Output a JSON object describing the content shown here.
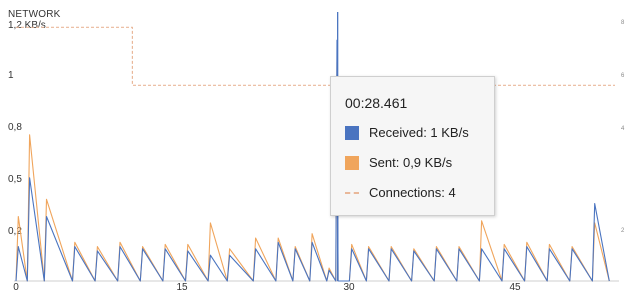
{
  "panel": {
    "title": "NETWORK",
    "right_scale_ticks": [
      "8",
      "6",
      "4",
      "2"
    ]
  },
  "tooltip": {
    "time": "00:28.461",
    "rows": [
      {
        "label": "Received: 1 KB/s",
        "color": "#4a74c0",
        "kind": "swatch"
      },
      {
        "label": "Sent: 0,9 KB/s",
        "color": "#f0a55c",
        "kind": "swatch"
      },
      {
        "label": "Connections: 4",
        "color": "#e9b89a",
        "kind": "dash"
      }
    ]
  },
  "chart_data": {
    "type": "line",
    "title": "NETWORK",
    "y_ticks": [
      "1,2 KB/s",
      "1",
      "0,8",
      "0,5",
      "0,2"
    ],
    "x_ticks": [
      "0",
      "15",
      "30",
      "45"
    ],
    "xlim": [
      0,
      53
    ],
    "ylim": [
      0,
      1.2
    ],
    "grid": false,
    "cursor_x": 28.461,
    "colors": {
      "received": "#4a74c0",
      "sent": "#f0a55c",
      "connections": "#e9b89a"
    },
    "series": [
      {
        "name": "Received",
        "x": [
          0,
          0.2,
          1,
          1.2,
          2.5,
          2.7,
          5,
          5.2,
          7,
          7.2,
          9,
          9.2,
          11,
          11.2,
          13,
          13.2,
          15,
          15.2,
          17,
          17.2,
          18.7,
          18.9,
          21,
          21.2,
          23,
          23.2,
          24.5,
          24.7,
          26,
          26.2,
          27.5,
          27.7,
          28.3,
          28.4,
          28.5,
          29.5,
          29.7,
          31,
          31.2,
          33,
          33.2,
          35,
          35.2,
          37,
          37.2,
          39,
          39.2,
          41,
          41.2,
          43,
          43.2,
          45,
          45.2,
          47,
          47.2,
          49,
          49.2,
          51,
          51.2,
          52.5
        ],
        "y": [
          0,
          0.16,
          0,
          0.48,
          0,
          0.3,
          0,
          0.16,
          0,
          0.14,
          0,
          0.16,
          0,
          0.15,
          0,
          0.15,
          0,
          0.14,
          0,
          0.12,
          0,
          0.12,
          0,
          0.15,
          0,
          0.18,
          0,
          0.15,
          0,
          0.18,
          0,
          0.05,
          0,
          1.12,
          0,
          0,
          0.15,
          0,
          0.15,
          0,
          0.15,
          0,
          0.14,
          0,
          0.15,
          0,
          0.15,
          0,
          0.15,
          0,
          0.15,
          0,
          0.16,
          0,
          0.15,
          0,
          0.15,
          0,
          0.36,
          0
        ]
      },
      {
        "name": "Sent",
        "x": [
          0,
          0.2,
          1,
          1.2,
          2.5,
          2.7,
          5,
          5.2,
          7,
          7.2,
          9,
          9.2,
          11,
          11.2,
          13,
          13.2,
          15,
          15.2,
          17,
          17.2,
          18.7,
          18.9,
          21,
          21.2,
          23,
          23.2,
          24.5,
          24.7,
          26,
          26.2,
          27.5,
          27.7,
          28.3,
          28.4,
          28.5,
          29.5,
          29.7,
          31,
          31.2,
          33,
          33.2,
          35,
          35.2,
          37,
          37.2,
          39,
          39.2,
          41,
          41.2,
          43,
          43.2,
          45,
          45.2,
          47,
          47.2,
          49,
          49.2,
          51,
          51.2,
          52.5
        ],
        "y": [
          0,
          0.3,
          0,
          0.68,
          0,
          0.38,
          0,
          0.18,
          0,
          0.16,
          0,
          0.18,
          0,
          0.16,
          0,
          0.17,
          0,
          0.17,
          0,
          0.27,
          0,
          0.15,
          0,
          0.2,
          0,
          0.2,
          0,
          0.16,
          0,
          0.22,
          0,
          0.06,
          0,
          1.02,
          0,
          0,
          0.17,
          0,
          0.16,
          0,
          0.16,
          0,
          0.15,
          0,
          0.16,
          0,
          0.16,
          0,
          0.28,
          0,
          0.17,
          0,
          0.18,
          0,
          0.17,
          0,
          0.16,
          0,
          0.27,
          0
        ]
      },
      {
        "name": "Connections",
        "x": [
          0,
          10.3,
          10.3,
          53
        ],
        "y": [
          1.18,
          1.18,
          0.91,
          0.91
        ]
      }
    ]
  }
}
